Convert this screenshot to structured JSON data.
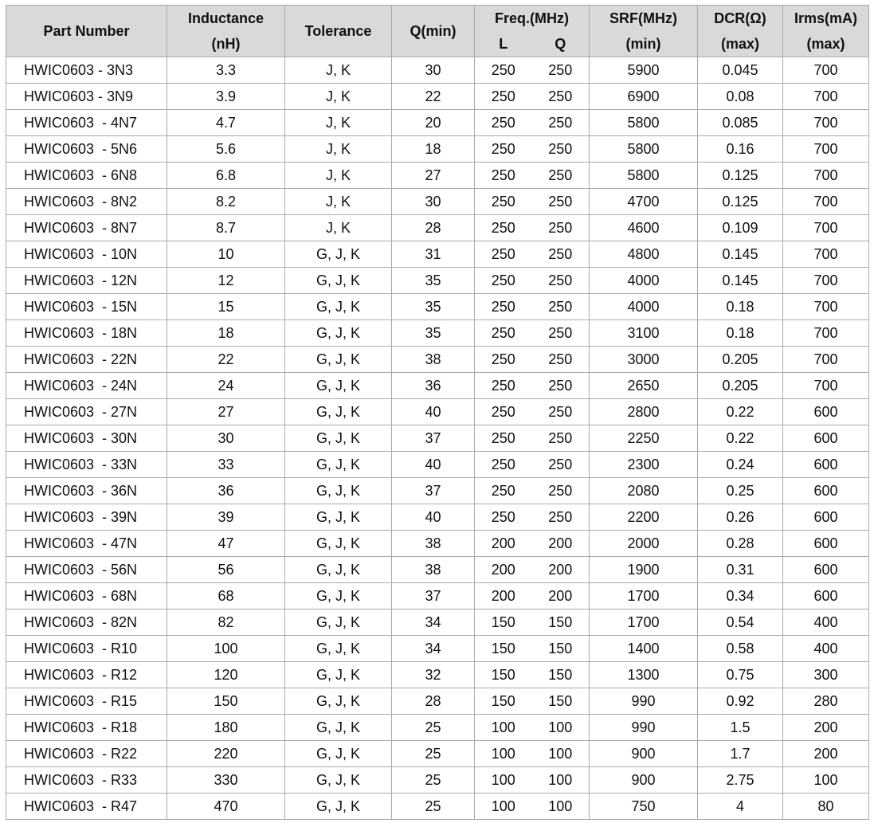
{
  "headers": {
    "part_number": "Part Number",
    "inductance": "Inductance",
    "inductance_unit": "(nH)",
    "tolerance": "Tolerance",
    "q_min": "Q(min)",
    "freq": "Freq.(MHz)",
    "freq_l": "L",
    "freq_q": "Q",
    "srf": "SRF(MHz)",
    "srf_sub": "(min)",
    "dcr": "DCR(Ω)",
    "dcr_sub": "(max)",
    "irms": "Irms(mA)",
    "irms_sub": "(max)"
  },
  "rows": [
    {
      "part": "HWIC0603 - 3N3",
      "ind": "3.3",
      "tol": "J, K",
      "q": "30",
      "fl": "250",
      "fq": "250",
      "srf": "5900",
      "dcr": "0.045",
      "irms": "700"
    },
    {
      "part": "HWIC0603 - 3N9",
      "ind": "3.9",
      "tol": "J, K",
      "q": "22",
      "fl": "250",
      "fq": "250",
      "srf": "6900",
      "dcr": "0.08",
      "irms": "700"
    },
    {
      "part": "HWIC0603  - 4N7",
      "ind": "4.7",
      "tol": "J, K",
      "q": "20",
      "fl": "250",
      "fq": "250",
      "srf": "5800",
      "dcr": "0.085",
      "irms": "700"
    },
    {
      "part": "HWIC0603  - 5N6",
      "ind": "5.6",
      "tol": "J, K",
      "q": "18",
      "fl": "250",
      "fq": "250",
      "srf": "5800",
      "dcr": "0.16",
      "irms": "700"
    },
    {
      "part": "HWIC0603  - 6N8",
      "ind": "6.8",
      "tol": "J, K",
      "q": "27",
      "fl": "250",
      "fq": "250",
      "srf": "5800",
      "dcr": "0.125",
      "irms": "700"
    },
    {
      "part": "HWIC0603  - 8N2",
      "ind": "8.2",
      "tol": "J, K",
      "q": "30",
      "fl": "250",
      "fq": "250",
      "srf": "4700",
      "dcr": "0.125",
      "irms": "700"
    },
    {
      "part": "HWIC0603  - 8N7",
      "ind": "8.7",
      "tol": "J, K",
      "q": "28",
      "fl": "250",
      "fq": "250",
      "srf": "4600",
      "dcr": "0.109",
      "irms": "700"
    },
    {
      "part": "HWIC0603  - 10N",
      "ind": "10",
      "tol": "G, J, K",
      "q": "31",
      "fl": "250",
      "fq": "250",
      "srf": "4800",
      "dcr": "0.145",
      "irms": "700"
    },
    {
      "part": "HWIC0603  - 12N",
      "ind": "12",
      "tol": "G, J, K",
      "q": "35",
      "fl": "250",
      "fq": "250",
      "srf": "4000",
      "dcr": "0.145",
      "irms": "700"
    },
    {
      "part": "HWIC0603  - 15N",
      "ind": "15",
      "tol": "G, J, K",
      "q": "35",
      "fl": "250",
      "fq": "250",
      "srf": "4000",
      "dcr": "0.18",
      "irms": "700"
    },
    {
      "part": "HWIC0603  - 18N",
      "ind": "18",
      "tol": "G, J, K",
      "q": "35",
      "fl": "250",
      "fq": "250",
      "srf": "3100",
      "dcr": "0.18",
      "irms": "700"
    },
    {
      "part": "HWIC0603  - 22N",
      "ind": "22",
      "tol": "G, J, K",
      "q": "38",
      "fl": "250",
      "fq": "250",
      "srf": "3000",
      "dcr": "0.205",
      "irms": "700"
    },
    {
      "part": "HWIC0603  - 24N",
      "ind": "24",
      "tol": "G, J, K",
      "q": "36",
      "fl": "250",
      "fq": "250",
      "srf": "2650",
      "dcr": "0.205",
      "irms": "700"
    },
    {
      "part": "HWIC0603  - 27N",
      "ind": "27",
      "tol": "G, J, K",
      "q": "40",
      "fl": "250",
      "fq": "250",
      "srf": "2800",
      "dcr": "0.22",
      "irms": "600"
    },
    {
      "part": "HWIC0603  - 30N",
      "ind": "30",
      "tol": "G, J, K",
      "q": "37",
      "fl": "250",
      "fq": "250",
      "srf": "2250",
      "dcr": "0.22",
      "irms": "600"
    },
    {
      "part": "HWIC0603  - 33N",
      "ind": "33",
      "tol": "G, J, K",
      "q": "40",
      "fl": "250",
      "fq": "250",
      "srf": "2300",
      "dcr": "0.24",
      "irms": "600"
    },
    {
      "part": "HWIC0603  - 36N",
      "ind": "36",
      "tol": "G, J, K",
      "q": "37",
      "fl": "250",
      "fq": "250",
      "srf": "2080",
      "dcr": "0.25",
      "irms": "600"
    },
    {
      "part": "HWIC0603  - 39N",
      "ind": "39",
      "tol": "G, J, K",
      "q": "40",
      "fl": "250",
      "fq": "250",
      "srf": "2200",
      "dcr": "0.26",
      "irms": "600"
    },
    {
      "part": "HWIC0603  - 47N",
      "ind": "47",
      "tol": "G, J, K",
      "q": "38",
      "fl": "200",
      "fq": "200",
      "srf": "2000",
      "dcr": "0.28",
      "irms": "600"
    },
    {
      "part": "HWIC0603  - 56N",
      "ind": "56",
      "tol": "G, J, K",
      "q": "38",
      "fl": "200",
      "fq": "200",
      "srf": "1900",
      "dcr": "0.31",
      "irms": "600"
    },
    {
      "part": "HWIC0603  - 68N",
      "ind": "68",
      "tol": "G, J, K",
      "q": "37",
      "fl": "200",
      "fq": "200",
      "srf": "1700",
      "dcr": "0.34",
      "irms": "600"
    },
    {
      "part": "HWIC0603  - 82N",
      "ind": "82",
      "tol": "G, J, K",
      "q": "34",
      "fl": "150",
      "fq": "150",
      "srf": "1700",
      "dcr": "0.54",
      "irms": "400"
    },
    {
      "part": "HWIC0603  - R10",
      "ind": "100",
      "tol": "G, J, K",
      "q": "34",
      "fl": "150",
      "fq": "150",
      "srf": "1400",
      "dcr": "0.58",
      "irms": "400"
    },
    {
      "part": "HWIC0603  - R12",
      "ind": "120",
      "tol": "G, J, K",
      "q": "32",
      "fl": "150",
      "fq": "150",
      "srf": "1300",
      "dcr": "0.75",
      "irms": "300"
    },
    {
      "part": "HWIC0603  - R15",
      "ind": "150",
      "tol": "G, J, K",
      "q": "28",
      "fl": "150",
      "fq": "150",
      "srf": "990",
      "dcr": "0.92",
      "irms": "280"
    },
    {
      "part": "HWIC0603  - R18",
      "ind": "180",
      "tol": "G, J, K",
      "q": "25",
      "fl": "100",
      "fq": "100",
      "srf": "990",
      "dcr": "1.5",
      "irms": "200"
    },
    {
      "part": "HWIC0603  - R22",
      "ind": "220",
      "tol": "G, J, K",
      "q": "25",
      "fl": "100",
      "fq": "100",
      "srf": "900",
      "dcr": "1.7",
      "irms": "200"
    },
    {
      "part": "HWIC0603  - R33",
      "ind": "330",
      "tol": "G, J, K",
      "q": "25",
      "fl": "100",
      "fq": "100",
      "srf": "900",
      "dcr": "2.75",
      "irms": "100"
    },
    {
      "part": "HWIC0603  - R47",
      "ind": "470",
      "tol": "G, J, K",
      "q": "25",
      "fl": "100",
      "fq": "100",
      "srf": "750",
      "dcr": "4",
      "irms": "80"
    }
  ]
}
